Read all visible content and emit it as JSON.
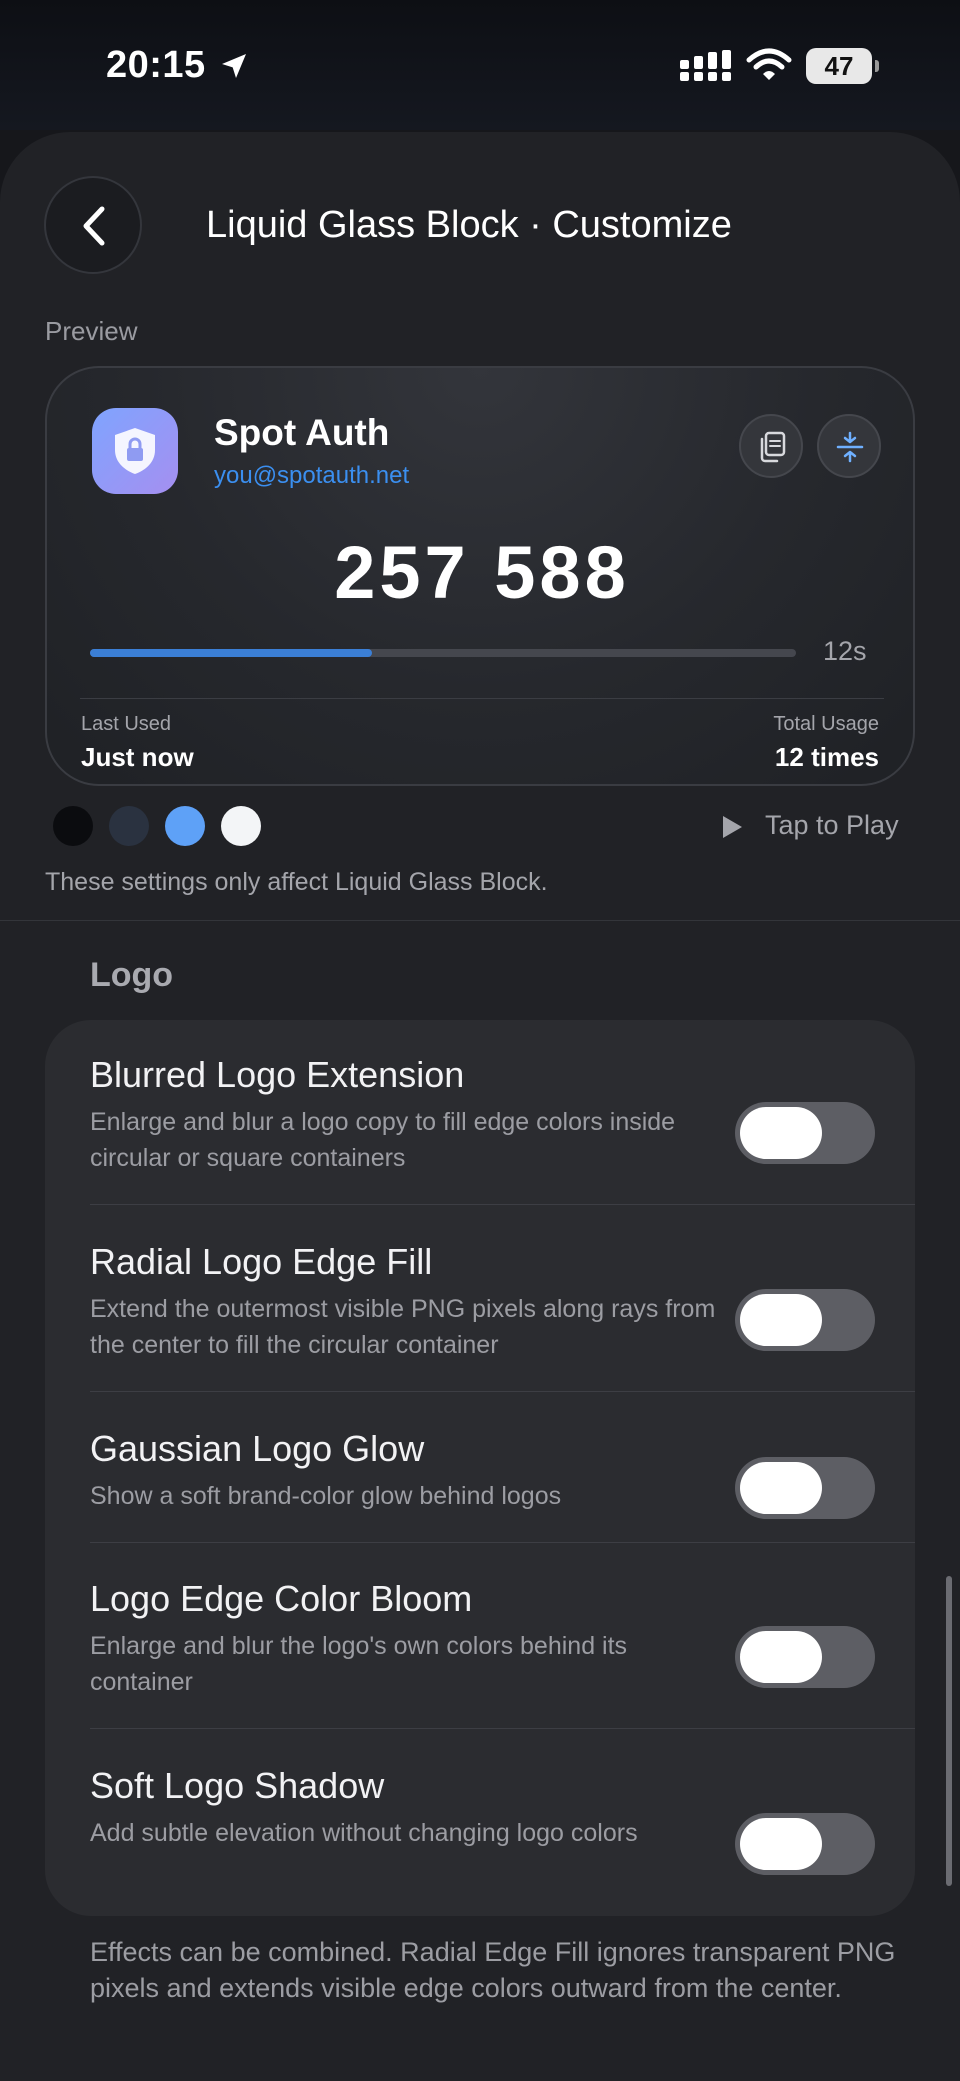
{
  "status_bar": {
    "time": "20:15",
    "battery": "47",
    "icons": [
      "location-arrow-icon",
      "cellular-signal-icon",
      "wifi-icon",
      "battery-icon"
    ]
  },
  "nav": {
    "title": "Liquid Glass Block · Customize",
    "back_icon": "chevron-left-icon"
  },
  "preview": {
    "label": "Preview",
    "card": {
      "app_name": "Spot Auth",
      "email": "you@spotauth.net",
      "code": "257 588",
      "seconds": "12s",
      "progress": 0.4,
      "last_used_label": "Last Used",
      "last_used_value": "Just now",
      "total_usage_label": "Total Usage",
      "total_usage_value": "12 times",
      "icons": [
        "shield-lock-icon",
        "copy-icon",
        "split-icon"
      ]
    },
    "swatches": [
      "#0b0c0f",
      "#2a3240",
      "#5ea1f7",
      "#f3f5f7"
    ],
    "tap_to_play": "Tap to Play",
    "notice": "These settings only affect Liquid Glass Block."
  },
  "logo_section": {
    "header": "Logo",
    "rows": [
      {
        "title": "Blurred Logo Extension",
        "desc": "Enlarge and blur a logo copy to fill edge colors inside circular or square containers",
        "on": false
      },
      {
        "title": "Radial Logo Edge Fill",
        "desc": "Extend the outermost visible PNG pixels along rays from the center to fill the circular container",
        "on": false
      },
      {
        "title": "Gaussian Logo Glow",
        "desc": "Show a soft brand-color glow behind logos",
        "on": false
      },
      {
        "title": "Logo Edge Color Bloom",
        "desc": "Enlarge and blur the logo's own colors behind its container",
        "on": false
      },
      {
        "title": "Soft Logo Shadow",
        "desc": "Add subtle elevation without changing logo colors",
        "on": false
      }
    ],
    "footer": "Effects can be combined. Radial Edge Fill ignores transparent PNG pixels and extends visible edge colors outward from the center."
  },
  "colors": {
    "accent": "#3b8ff0",
    "progress": "#3b7fd6",
    "background": "#16171b",
    "toggle_off": "#5d5e64"
  }
}
